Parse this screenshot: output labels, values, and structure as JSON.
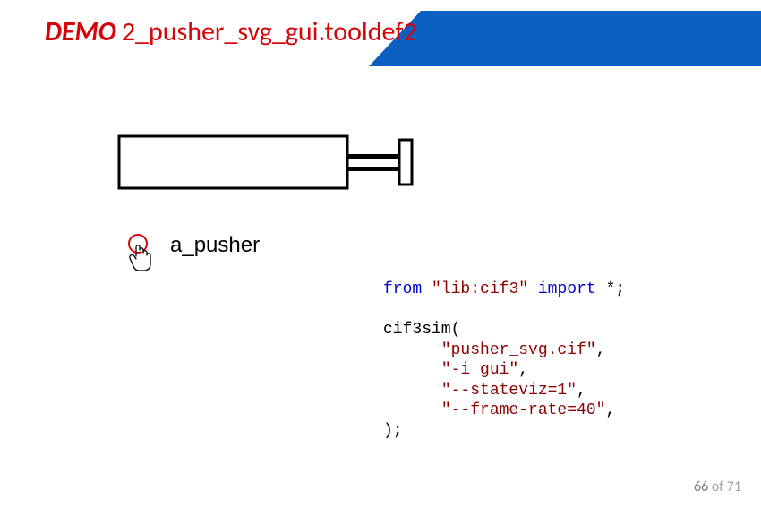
{
  "title": {
    "demo": "DEMO",
    "rest": "2_pusher_svg_gui.tooldef2"
  },
  "diagram": {
    "label": "a_pusher"
  },
  "code": {
    "kw_from": "from",
    "lib_str": "\"lib:cif3\"",
    "kw_import": "import",
    "star": "*",
    "semi": ";",
    "fn": "cif3sim",
    "args": [
      "\"pusher_svg.cif\"",
      "\"-i gui\"",
      "\"--stateviz=1\"",
      "\"--frame-rate=40\""
    ],
    "close": ");"
  },
  "page": {
    "current": "66",
    "of_word": "of",
    "total": "71"
  }
}
